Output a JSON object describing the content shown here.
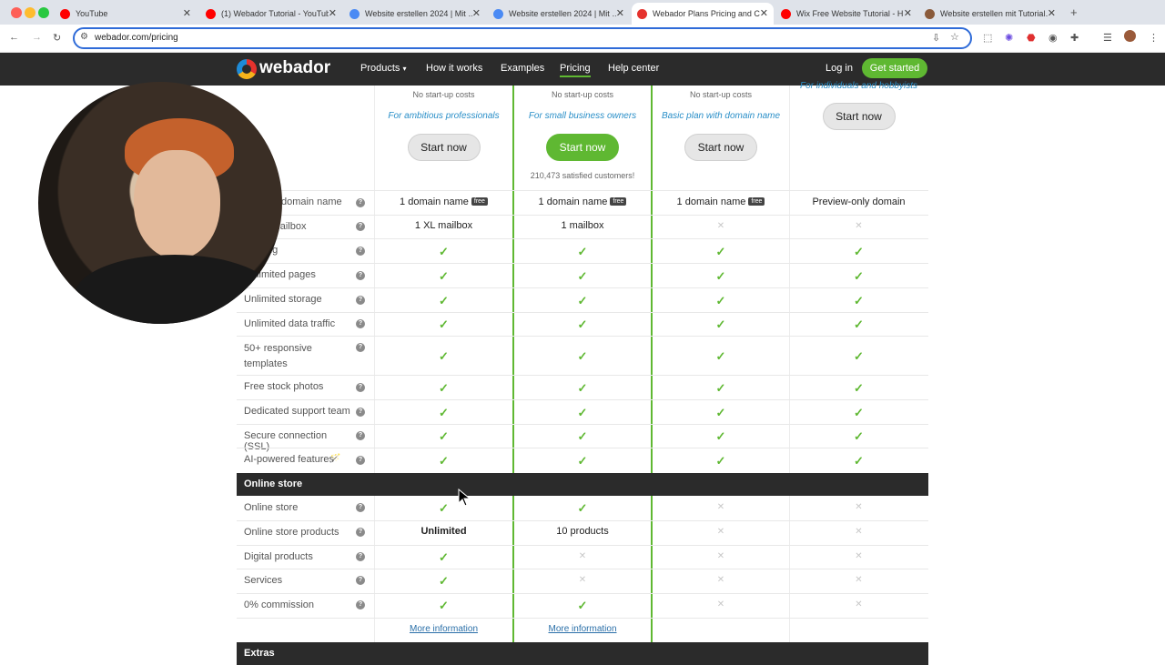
{
  "browser": {
    "tabs": [
      {
        "label": "YouTube",
        "favicon_color": "#ff0000"
      },
      {
        "label": "(1) Webador Tutorial - YouTube",
        "favicon_color": "#ff0000"
      },
      {
        "label": "Website erstellen 2024 | Mit …",
        "favicon_color": "#4a8af4"
      },
      {
        "label": "Website erstellen 2024 | Mit …",
        "favicon_color": "#4a8af4"
      },
      {
        "label": "Webador Plans Pricing and C…",
        "favicon_color": "#e5322d"
      },
      {
        "label": "Wix Free Website Tutorial - H…",
        "favicon_color": "#ff0000"
      },
      {
        "label": "Website erstellen mit Tutorial…",
        "favicon_color": "#8a5a3a"
      }
    ],
    "new_tab": "+",
    "url": "webador.com/pricing"
  },
  "site_nav": {
    "brand": "webador",
    "links": [
      "Products",
      "How it works",
      "Examples",
      "Pricing",
      "Help center"
    ],
    "login": "Log in",
    "cta": "Get started"
  },
  "plans": [
    {
      "note": "No start-up costs",
      "tagline": "For ambitious professionals",
      "button": "Start now",
      "extra": ""
    },
    {
      "note": "No start-up costs",
      "tagline": "For small business owners",
      "button": "Start now",
      "extra": "210,473 satisfied customers!"
    },
    {
      "note": "No start-up costs",
      "tagline": "Basic plan with domain name",
      "button": "Start now",
      "extra": ""
    },
    {
      "note": "",
      "tagline": "For individuals and hobbyists",
      "button": "Start now",
      "extra": ""
    }
  ],
  "rows": [
    {
      "label": "Custom domain name",
      "values": [
        "1 domain name",
        "1 domain name",
        "1 domain name",
        "Preview-only domain"
      ],
      "free": [
        true,
        true,
        true,
        false
      ]
    },
    {
      "label": "Email mailbox",
      "values": [
        "1 XL mailbox",
        "1 mailbox",
        "x",
        "x"
      ]
    },
    {
      "label": "Hosting",
      "values": [
        "check",
        "check",
        "check",
        "check"
      ]
    },
    {
      "label": "Unlimited pages",
      "values": [
        "check",
        "check",
        "check",
        "check"
      ]
    },
    {
      "label": "Unlimited storage",
      "values": [
        "check",
        "check",
        "check",
        "check"
      ]
    },
    {
      "label": "Unlimited data traffic",
      "values": [
        "check",
        "check",
        "check",
        "check"
      ]
    },
    {
      "label": "50+ responsive templates",
      "values": [
        "check",
        "check",
        "check",
        "check"
      ]
    },
    {
      "label": "Free stock photos",
      "values": [
        "check",
        "check",
        "check",
        "check"
      ]
    },
    {
      "label": "Dedicated support team",
      "values": [
        "check",
        "check",
        "check",
        "check"
      ]
    },
    {
      "label": "Secure connection (SSL)",
      "values": [
        "check",
        "check",
        "check",
        "check"
      ]
    },
    {
      "label": "AI-powered features",
      "values": [
        "check",
        "check",
        "check",
        "check"
      ]
    }
  ],
  "online_store": {
    "title": "Online store",
    "rows": [
      {
        "label": "Online store",
        "values": [
          "check",
          "check",
          "x",
          "x"
        ]
      },
      {
        "label": "Online store products",
        "values": [
          "Unlimited",
          "10 products",
          "x",
          "x"
        ]
      },
      {
        "label": "Digital products",
        "values": [
          "check",
          "x",
          "x",
          "x"
        ]
      },
      {
        "label": "Services",
        "values": [
          "check",
          "x",
          "x",
          "x"
        ]
      },
      {
        "label": "0% commission",
        "values": [
          "check",
          "check",
          "x",
          "x"
        ]
      }
    ],
    "more_info": [
      "More information",
      "More information"
    ]
  },
  "extras_title": "Extras",
  "free_badge": "free",
  "help_glyph": "?"
}
